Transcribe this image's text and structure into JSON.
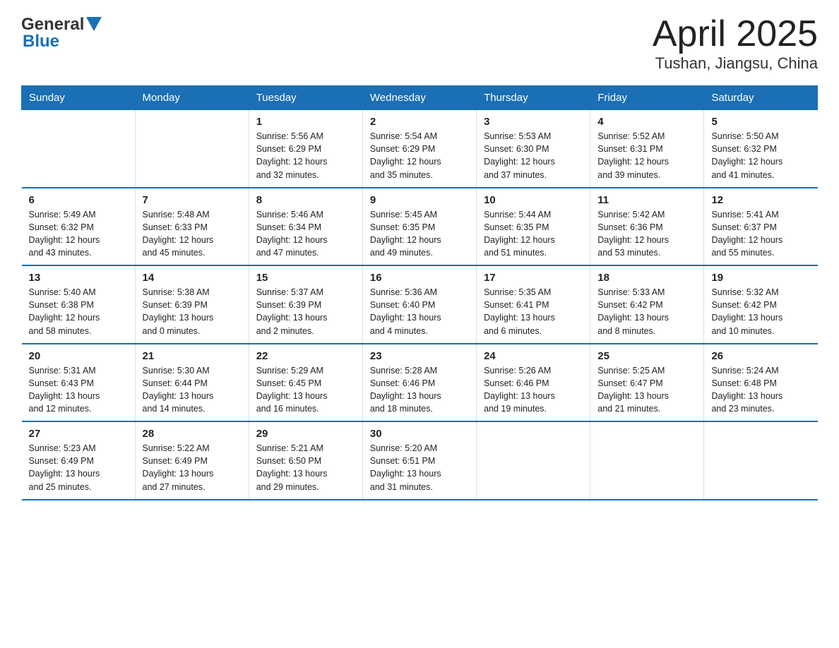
{
  "header": {
    "logo_general": "General",
    "logo_blue": "Blue",
    "title": "April 2025",
    "subtitle": "Tushan, Jiangsu, China"
  },
  "calendar": {
    "columns": [
      "Sunday",
      "Monday",
      "Tuesday",
      "Wednesday",
      "Thursday",
      "Friday",
      "Saturday"
    ],
    "rows": [
      [
        {
          "day": "",
          "info": ""
        },
        {
          "day": "",
          "info": ""
        },
        {
          "day": "1",
          "info": "Sunrise: 5:56 AM\nSunset: 6:29 PM\nDaylight: 12 hours\nand 32 minutes."
        },
        {
          "day": "2",
          "info": "Sunrise: 5:54 AM\nSunset: 6:29 PM\nDaylight: 12 hours\nand 35 minutes."
        },
        {
          "day": "3",
          "info": "Sunrise: 5:53 AM\nSunset: 6:30 PM\nDaylight: 12 hours\nand 37 minutes."
        },
        {
          "day": "4",
          "info": "Sunrise: 5:52 AM\nSunset: 6:31 PM\nDaylight: 12 hours\nand 39 minutes."
        },
        {
          "day": "5",
          "info": "Sunrise: 5:50 AM\nSunset: 6:32 PM\nDaylight: 12 hours\nand 41 minutes."
        }
      ],
      [
        {
          "day": "6",
          "info": "Sunrise: 5:49 AM\nSunset: 6:32 PM\nDaylight: 12 hours\nand 43 minutes."
        },
        {
          "day": "7",
          "info": "Sunrise: 5:48 AM\nSunset: 6:33 PM\nDaylight: 12 hours\nand 45 minutes."
        },
        {
          "day": "8",
          "info": "Sunrise: 5:46 AM\nSunset: 6:34 PM\nDaylight: 12 hours\nand 47 minutes."
        },
        {
          "day": "9",
          "info": "Sunrise: 5:45 AM\nSunset: 6:35 PM\nDaylight: 12 hours\nand 49 minutes."
        },
        {
          "day": "10",
          "info": "Sunrise: 5:44 AM\nSunset: 6:35 PM\nDaylight: 12 hours\nand 51 minutes."
        },
        {
          "day": "11",
          "info": "Sunrise: 5:42 AM\nSunset: 6:36 PM\nDaylight: 12 hours\nand 53 minutes."
        },
        {
          "day": "12",
          "info": "Sunrise: 5:41 AM\nSunset: 6:37 PM\nDaylight: 12 hours\nand 55 minutes."
        }
      ],
      [
        {
          "day": "13",
          "info": "Sunrise: 5:40 AM\nSunset: 6:38 PM\nDaylight: 12 hours\nand 58 minutes."
        },
        {
          "day": "14",
          "info": "Sunrise: 5:38 AM\nSunset: 6:39 PM\nDaylight: 13 hours\nand 0 minutes."
        },
        {
          "day": "15",
          "info": "Sunrise: 5:37 AM\nSunset: 6:39 PM\nDaylight: 13 hours\nand 2 minutes."
        },
        {
          "day": "16",
          "info": "Sunrise: 5:36 AM\nSunset: 6:40 PM\nDaylight: 13 hours\nand 4 minutes."
        },
        {
          "day": "17",
          "info": "Sunrise: 5:35 AM\nSunset: 6:41 PM\nDaylight: 13 hours\nand 6 minutes."
        },
        {
          "day": "18",
          "info": "Sunrise: 5:33 AM\nSunset: 6:42 PM\nDaylight: 13 hours\nand 8 minutes."
        },
        {
          "day": "19",
          "info": "Sunrise: 5:32 AM\nSunset: 6:42 PM\nDaylight: 13 hours\nand 10 minutes."
        }
      ],
      [
        {
          "day": "20",
          "info": "Sunrise: 5:31 AM\nSunset: 6:43 PM\nDaylight: 13 hours\nand 12 minutes."
        },
        {
          "day": "21",
          "info": "Sunrise: 5:30 AM\nSunset: 6:44 PM\nDaylight: 13 hours\nand 14 minutes."
        },
        {
          "day": "22",
          "info": "Sunrise: 5:29 AM\nSunset: 6:45 PM\nDaylight: 13 hours\nand 16 minutes."
        },
        {
          "day": "23",
          "info": "Sunrise: 5:28 AM\nSunset: 6:46 PM\nDaylight: 13 hours\nand 18 minutes."
        },
        {
          "day": "24",
          "info": "Sunrise: 5:26 AM\nSunset: 6:46 PM\nDaylight: 13 hours\nand 19 minutes."
        },
        {
          "day": "25",
          "info": "Sunrise: 5:25 AM\nSunset: 6:47 PM\nDaylight: 13 hours\nand 21 minutes."
        },
        {
          "day": "26",
          "info": "Sunrise: 5:24 AM\nSunset: 6:48 PM\nDaylight: 13 hours\nand 23 minutes."
        }
      ],
      [
        {
          "day": "27",
          "info": "Sunrise: 5:23 AM\nSunset: 6:49 PM\nDaylight: 13 hours\nand 25 minutes."
        },
        {
          "day": "28",
          "info": "Sunrise: 5:22 AM\nSunset: 6:49 PM\nDaylight: 13 hours\nand 27 minutes."
        },
        {
          "day": "29",
          "info": "Sunrise: 5:21 AM\nSunset: 6:50 PM\nDaylight: 13 hours\nand 29 minutes."
        },
        {
          "day": "30",
          "info": "Sunrise: 5:20 AM\nSunset: 6:51 PM\nDaylight: 13 hours\nand 31 minutes."
        },
        {
          "day": "",
          "info": ""
        },
        {
          "day": "",
          "info": ""
        },
        {
          "day": "",
          "info": ""
        }
      ]
    ]
  }
}
